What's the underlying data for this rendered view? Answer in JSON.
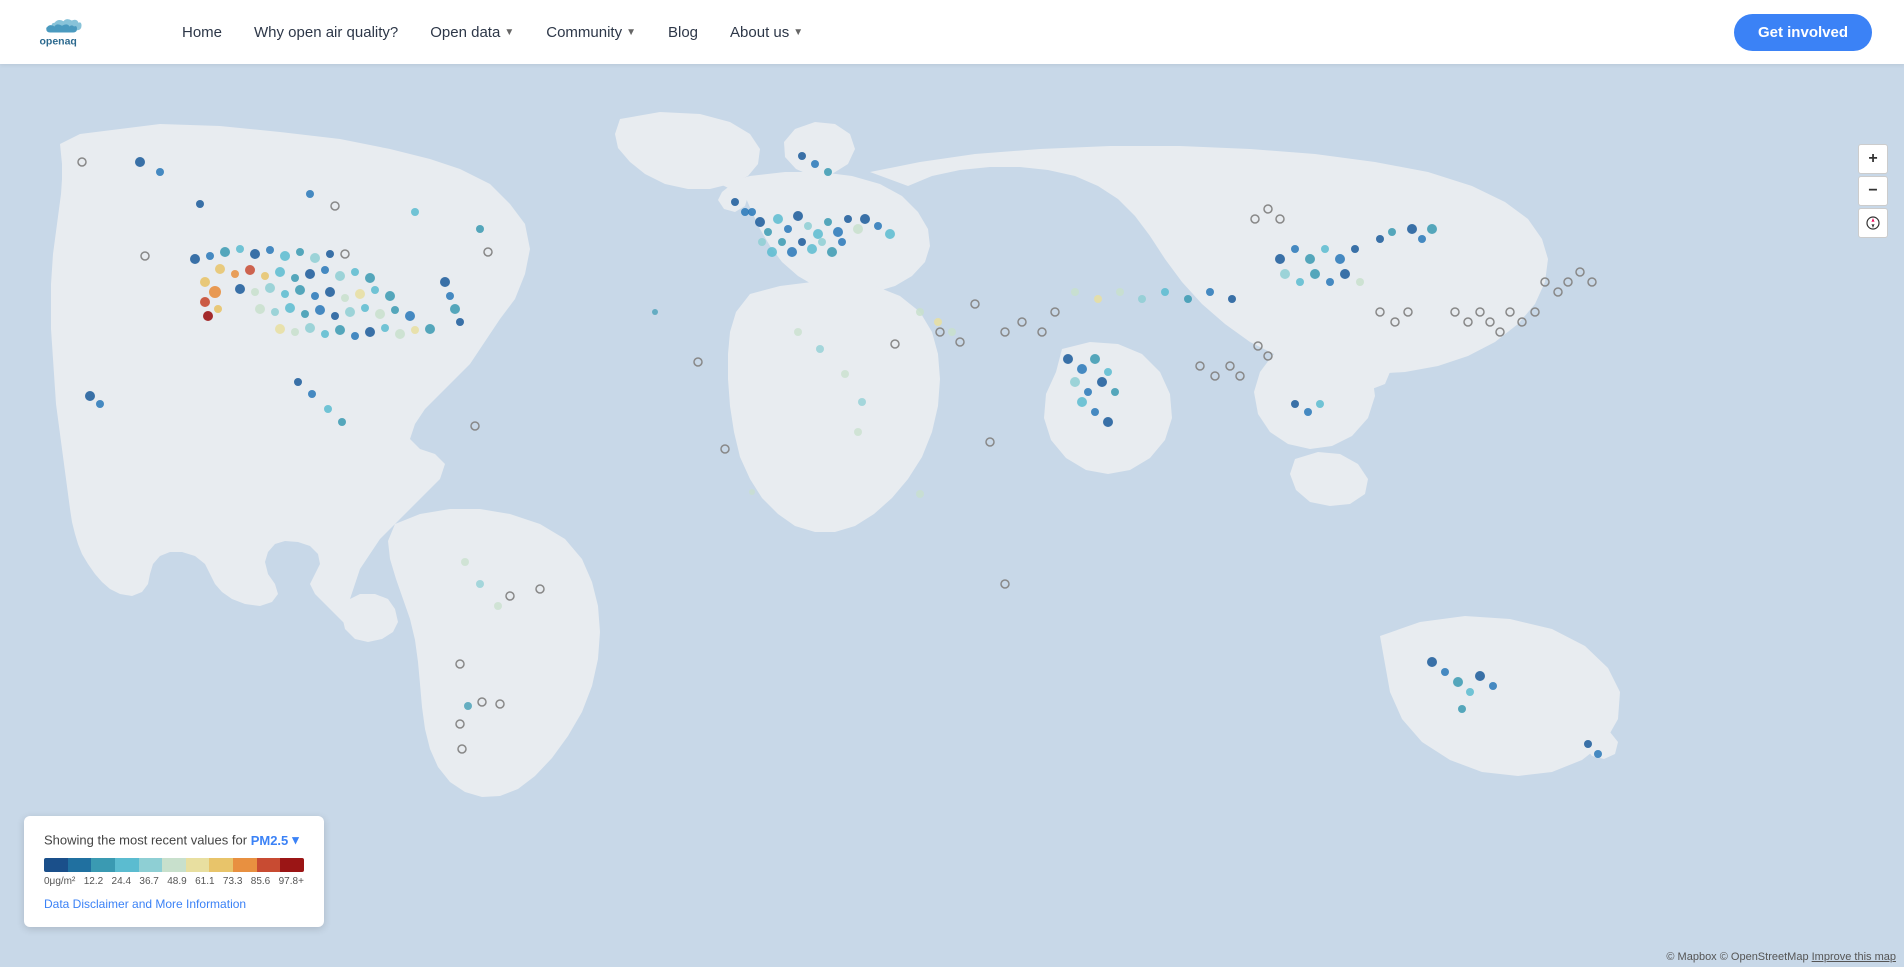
{
  "header": {
    "logo_alt": "OpenAQ",
    "nav": [
      {
        "label": "Home",
        "has_dropdown": false
      },
      {
        "label": "Why open air quality?",
        "has_dropdown": false
      },
      {
        "label": "Open data",
        "has_dropdown": true
      },
      {
        "label": "Community",
        "has_dropdown": true
      },
      {
        "label": "Blog",
        "has_dropdown": false
      },
      {
        "label": "About us",
        "has_dropdown": true
      }
    ],
    "cta_label": "Get involved"
  },
  "map": {
    "zoom_in": "+",
    "zoom_out": "−",
    "reset": "⊕"
  },
  "legend": {
    "showing_text": "Showing the most recent values for",
    "pollutant": "PM2.5",
    "colors": [
      "#1a4f8a",
      "#2070a0",
      "#3a9ab2",
      "#5bbcd0",
      "#8ecfd4",
      "#c8e0cc",
      "#e8dfa0",
      "#e8c46a",
      "#e89040",
      "#c84b32",
      "#9b1515"
    ],
    "labels": [
      "0μg/m²",
      "12.2",
      "24.4",
      "36.7",
      "48.9",
      "61.1",
      "73.3",
      "85.6",
      "97.8+"
    ],
    "disclaimer": "Data Disclaimer and More Information"
  },
  "attribution": {
    "text": "© Mapbox © OpenStreetMap",
    "improve": "Improve this map"
  }
}
